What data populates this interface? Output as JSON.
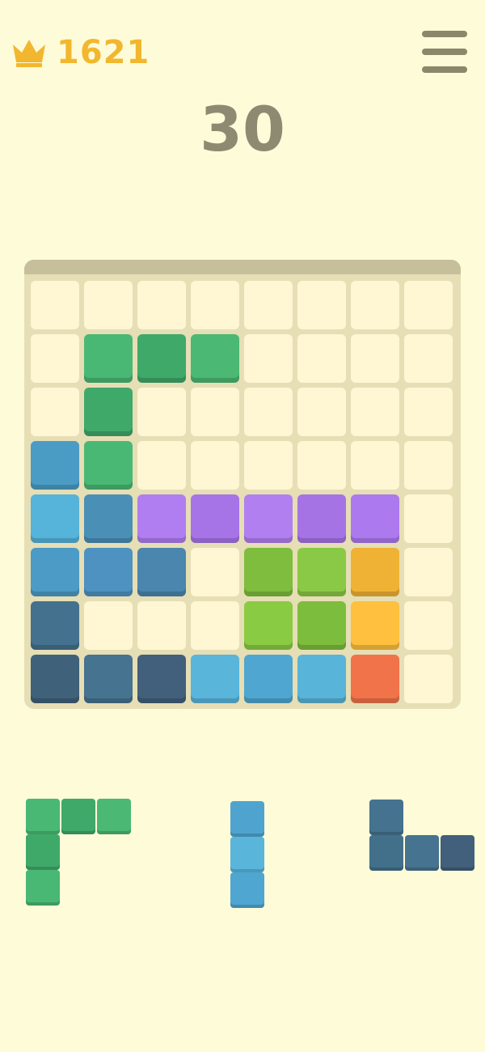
{
  "header": {
    "best_score": "1621",
    "score": "30",
    "crown_icon": "crown-icon",
    "menu_icon": "hamburger-menu-icon"
  },
  "colors": {
    "background": "#fefbd9",
    "accent_gold": "#f2b72e",
    "board_frame": "#e6deb5",
    "empty_cell": "#fff6d3"
  },
  "board": {
    "rows": 8,
    "cols": 8,
    "grid": [
      [
        null,
        null,
        null,
        null,
        null,
        null,
        null,
        null
      ],
      [
        null,
        "#49b874",
        "#3fa96a",
        "#4bb873",
        null,
        null,
        null,
        null
      ],
      [
        null,
        "#3fa96a",
        null,
        null,
        null,
        null,
        null,
        null
      ],
      [
        "#4a9cc4",
        "#49b874",
        null,
        null,
        null,
        null,
        null,
        null
      ],
      [
        "#56b3da",
        "#4a8fb6",
        "#b07ef0",
        "#a774e8",
        "#b27ff0",
        "#a673e4",
        "#ad79ee",
        null
      ],
      [
        "#4c9bc6",
        "#4e92c2",
        "#4a86ad",
        null,
        "#7ebd3d",
        "#8ac945",
        "#f0b234",
        null
      ],
      [
        "#44718d",
        null,
        null,
        null,
        "#8acb44",
        "#7dbd3d",
        "#fec03e",
        null
      ],
      [
        "#3f617a",
        "#46738f",
        "#425f7b",
        "#59b5da",
        "#4fa6d0",
        "#58b4d8",
        "#f07349",
        null
      ]
    ]
  },
  "tray": {
    "pieces": [
      {
        "name": "green-corner-piece",
        "blocks": [
          {
            "r": 0,
            "c": 0,
            "color": "#49b874"
          },
          {
            "r": 0,
            "c": 1,
            "color": "#3fa96a"
          },
          {
            "r": 0,
            "c": 2,
            "color": "#4bb873"
          },
          {
            "r": 1,
            "c": 0,
            "color": "#3fa96a"
          },
          {
            "r": 2,
            "c": 0,
            "color": "#49b874"
          }
        ]
      },
      {
        "name": "blue-vertical-bar-piece",
        "blocks": [
          {
            "r": 0,
            "c": 0,
            "color": "#4ea4cf"
          },
          {
            "r": 1,
            "c": 0,
            "color": "#59b5da"
          },
          {
            "r": 2,
            "c": 0,
            "color": "#4fa6d0"
          }
        ]
      },
      {
        "name": "navy-l-piece",
        "blocks": [
          {
            "r": 0,
            "c": 0,
            "color": "#45728e"
          },
          {
            "r": 1,
            "c": 0,
            "color": "#42708b"
          },
          {
            "r": 1,
            "c": 1,
            "color": "#46738f"
          },
          {
            "r": 1,
            "c": 2,
            "color": "#425f7b"
          }
        ]
      }
    ]
  }
}
